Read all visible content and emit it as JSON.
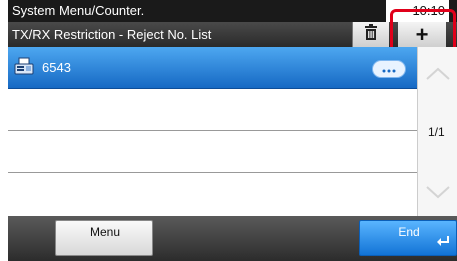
{
  "header": {
    "title": "System Menu/Counter.",
    "time": "10:10"
  },
  "subheader": {
    "title": "TX/RX Restriction - Reject No. List",
    "delete_icon": "trash-icon",
    "add_icon": "plus-icon",
    "add_label": "+"
  },
  "list": {
    "items": [
      {
        "label": "6543",
        "icon": "fax-icon",
        "selected": true
      },
      {
        "label": ""
      },
      {
        "label": ""
      },
      {
        "label": ""
      }
    ]
  },
  "pager": {
    "page_text": "1/1"
  },
  "footer": {
    "menu_label": "Menu",
    "end_label": "End"
  },
  "colors": {
    "selected_row": "#1f7fe0",
    "end_button": "#1a84e8",
    "highlight": "#e0001a"
  }
}
